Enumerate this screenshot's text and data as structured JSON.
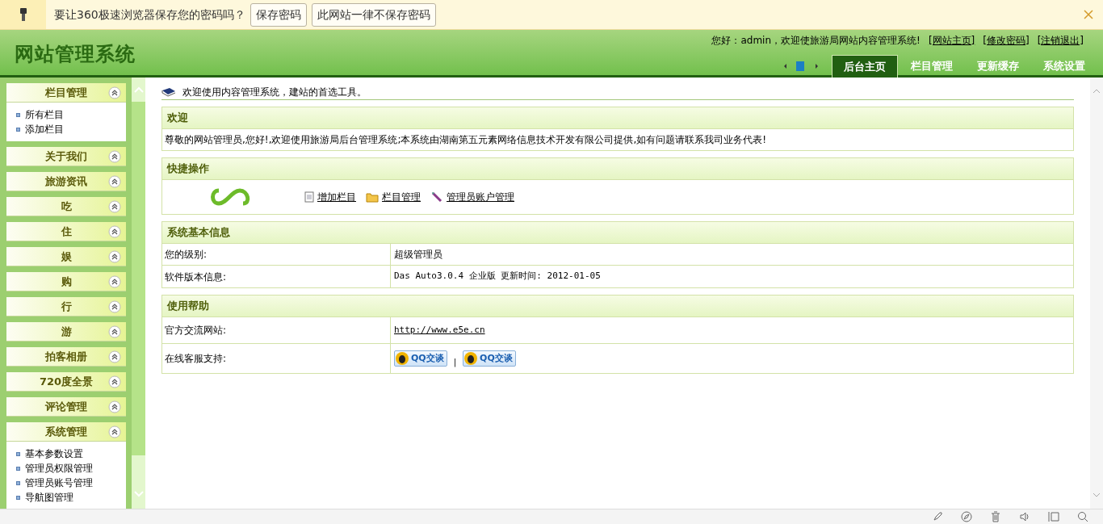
{
  "password_bar": {
    "message": "要让360极速浏览器保存您的密码吗？",
    "buttons": [
      "保存密码",
      "此网站一律不保存密码"
    ]
  },
  "header": {
    "logo": "网站管理系统",
    "greeting": "您好：admin，欢迎使旅游局网站内容管理系统!",
    "links": [
      "[网站主页]",
      "[修改密码]",
      "[注销退出]"
    ],
    "tabs": [
      {
        "label": "后台主页",
        "selected": true
      },
      {
        "label": "栏目管理",
        "selected": false
      },
      {
        "label": "更新缓存",
        "selected": false
      },
      {
        "label": "系统设置",
        "selected": false
      }
    ]
  },
  "sidebar": [
    {
      "title": "栏目管理",
      "expanded": true,
      "children": [
        "所有栏目",
        "添加栏目"
      ]
    },
    {
      "title": "关于我们",
      "expanded": false
    },
    {
      "title": "旅游资讯",
      "expanded": false
    },
    {
      "title": "吃",
      "expanded": false
    },
    {
      "title": "住",
      "expanded": false
    },
    {
      "title": "娱",
      "expanded": false
    },
    {
      "title": "购",
      "expanded": false
    },
    {
      "title": "行",
      "expanded": false
    },
    {
      "title": "游",
      "expanded": false
    },
    {
      "title": "拍客相册",
      "expanded": false
    },
    {
      "title": "720度全景",
      "expanded": false
    },
    {
      "title": "评论管理",
      "expanded": false
    },
    {
      "title": "系统管理",
      "expanded": true,
      "children": [
        "基本参数设置",
        "管理员权限管理",
        "管理员账号管理",
        "导航图管理"
      ]
    }
  ],
  "main": {
    "intro": "欢迎使用内容管理系统，建站的首选工具。",
    "welcome": {
      "title": "欢迎",
      "text": "尊敬的网站管理员,您好!,欢迎使用旅游局后台管理系统;本系统由湖南第五元素网络信息技术开发有限公司提供,如有问题请联系我司业务代表!"
    },
    "quick": {
      "title": "快捷操作",
      "links": [
        {
          "kind": "note",
          "label": "增加栏目"
        },
        {
          "kind": "folder",
          "label": "栏目管理"
        },
        {
          "kind": "tool",
          "label": "管理员账户管理"
        }
      ]
    },
    "sysinfo": {
      "title": "系统基本信息",
      "rows": [
        {
          "label": "您的级别:",
          "value": "超级管理员"
        },
        {
          "label": "软件版本信息:",
          "value": "Das Auto3.0.4 企业版 更新时间: 2012-01-05"
        }
      ]
    },
    "help": {
      "title": "使用帮助",
      "site_label": "官方交流网站:",
      "site_url": "http://www.e5e.cn",
      "support_label": "在线客服支持:",
      "qq_buttons": [
        "QQ交谈",
        "QQ交谈"
      ],
      "separator": "|"
    }
  }
}
